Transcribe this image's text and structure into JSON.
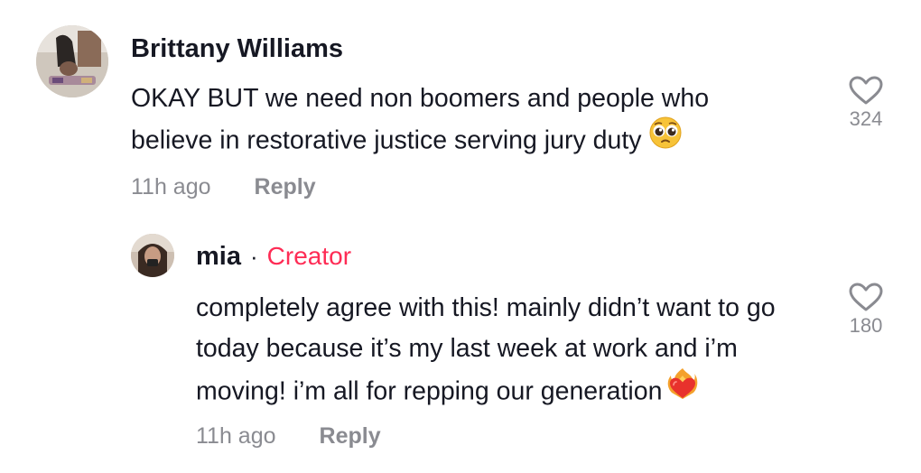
{
  "comments": [
    {
      "author": "Brittany Williams",
      "text": "OKAY BUT we need non boomers and people who believe in restorative justice serving jury duty",
      "emoji": "pleading-face",
      "time": "11h ago",
      "reply_label": "Reply",
      "likes": "324"
    }
  ],
  "replies": [
    {
      "author": "mia",
      "separator": "·",
      "badge": "Creator",
      "text": "completely agree with this! mainly didn’t want to go today because it’s my last week at work and i’m moving! i’m all for repping our generation",
      "emoji": "heart-on-fire",
      "time": "11h ago",
      "reply_label": "Reply",
      "likes": "180"
    }
  ],
  "colors": {
    "text": "#161823",
    "muted": "#8a8b91",
    "creator": "#fe2c55"
  }
}
